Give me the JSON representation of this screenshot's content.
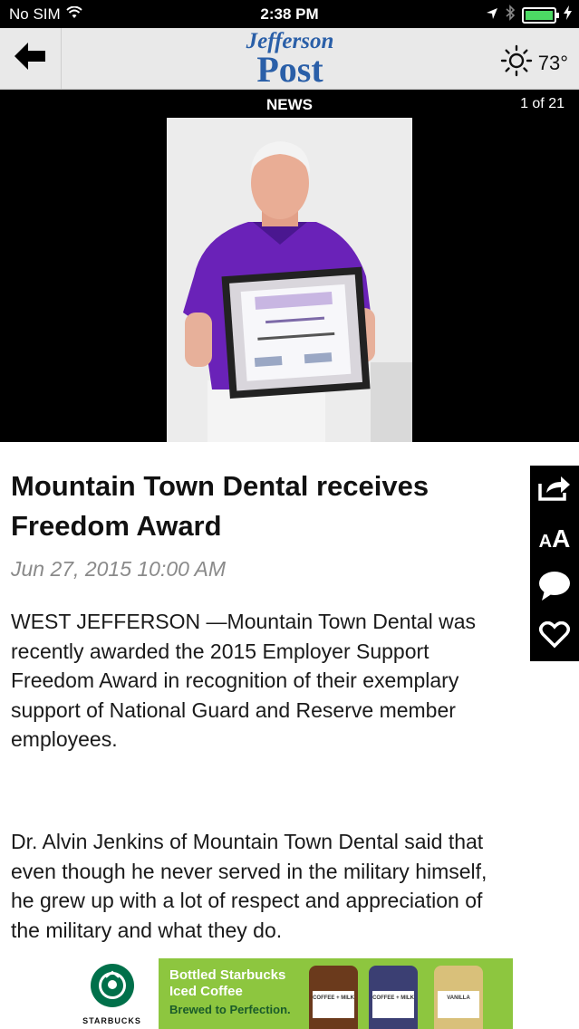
{
  "status_bar": {
    "carrier": "No SIM",
    "time": "2:38 PM"
  },
  "header": {
    "logo_line1": "Jefferson",
    "logo_line2": "Post",
    "temperature": "73°",
    "icons": [
      "back-arrow-icon",
      "sun-icon"
    ]
  },
  "media": {
    "section": "NEWS",
    "counter": "1 of 21"
  },
  "article": {
    "headline": "Mountain Town Dental receives Freedom Award",
    "date": "Jun 27, 2015 10:00 AM",
    "paragraphs": [
      "WEST JEFFERSON —Mountain Town Dental was recently awarded the 2015 Employer Support Freedom Award in recognition of their exemplary support of National Guard and Reserve member employees.",
      "Dr. Alvin Jenkins of Mountain Town Dental said that even though he never served in the military himself, he grew up with a lot of respect and appreciation of the military and what they do."
    ]
  },
  "toolbar": {
    "icons": [
      "share-icon",
      "font-size-icon",
      "comment-icon",
      "heart-icon"
    ],
    "font_small": "A",
    "font_large": "A"
  },
  "ad": {
    "brand": "STARBUCKS",
    "headline_1": "Bottled Starbucks",
    "headline_2": "Iced Coffee",
    "tagline": "Brewed to Perfection.",
    "bottles": [
      {
        "label": "COFFEE + MILK",
        "color": "#6b3a1c"
      },
      {
        "label": "COFFEE + MILK",
        "color": "#3b3f73"
      },
      {
        "label": "VANILLA",
        "color": "#d9c07a"
      }
    ]
  },
  "colors": {
    "logo_blue": "#2a5fa8",
    "ad_green": "#8dc63f",
    "battery_green": "#4cd964"
  }
}
